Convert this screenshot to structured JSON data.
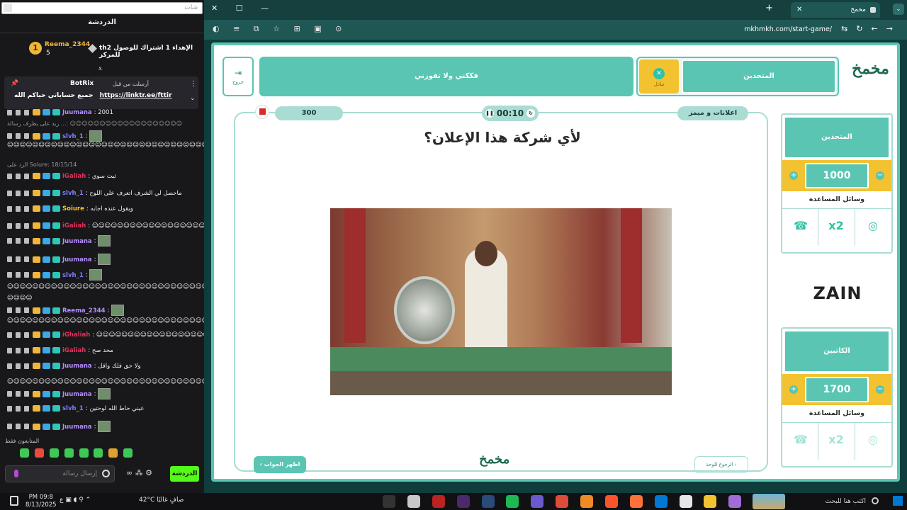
{
  "chat": {
    "search_placeholder": "شات",
    "title": "الدردشة",
    "hype": {
      "level": "1",
      "user": "Reema_2344",
      "count": "5",
      "text": "th2 الإهداء 1 اشتراك للوصول للمركز"
    },
    "pinned": {
      "by_label": "أرسلت من قبل",
      "bot_name": "BotRix",
      "message": "جميع حساباتي حياكم الله",
      "link": "https://linktr.ee/fttir"
    },
    "messages": [
      {
        "user": "Juumana",
        "text": "2001",
        "color": "#b58cff"
      },
      {
        "reply": "ريد على يطرف رسالة ...: ☺☺☺☺☺☺☺☺☺☺☺☺☺☺☺☺☺☺☺"
      },
      {
        "user": "slvh_1",
        "text": "",
        "color": "#7d7dff"
      },
      {
        "text_only": "☺☺☺☺☺☺☺☺☺☺☺☺☺☺☺☺☺☺☺☺☺☺☺☺☺☺☺☺☺☺☺☺☺☺☺☺☺☺☺☺☺☺☺☺☺☺☺☺☺☺☺☺☺"
      },
      {
        "reply": "الرد على Soiure: 18/15/14"
      },
      {
        "user": "iGaliah",
        "text": "ثبت سوي",
        "color": "#e0315b"
      },
      {
        "user": "slvh_1",
        "text": "ماحصل لي الشرف اتعرف على اللوح",
        "color": "#7d7dff"
      },
      {
        "user": "Soiure",
        "text": "ويقول عنده اجابه",
        "color": "#f2c230"
      },
      {
        "user": "iGaliah",
        "text": "☺☺☺☺☺☺☺☺☺☺☺☺☺☺☺☺☺☺☺☺☺☺☺☺☺☺",
        "color": "#e0315b"
      },
      {
        "user": "Juumana",
        "text": "",
        "color": "#b58cff"
      },
      {
        "user": "Juumana",
        "text": "",
        "color": "#b58cff"
      },
      {
        "user": "slvh_1",
        "text": "",
        "color": "#7d7dff"
      },
      {
        "text_only": "☺☺☺☺☺☺☺☺☺☺☺☺☺☺☺☺☺☺☺☺☺☺☺☺☺☺☺☺☺☺☺☺☺☺☺☺☺☺☺☺☺☺☺☺☺☺☺☺☺☺☺☺☺"
      },
      {
        "text_only": "☺☺☺☺"
      },
      {
        "user": "Reema_2344",
        "text": "",
        "color": "#b58cff"
      },
      {
        "text_only": "☺☺☺☺☺☺☺☺☺☺☺☺☺☺☺☺☺☺☺☺☺☺☺☺☺☺☺☺☺☺☺☺☺☺☺☺☺☺☺☺☺☺☺☺☺☺☺☺☺☺"
      },
      {
        "user": "iGhaliah",
        "text": "☺☺☺☺☺☺☺☺☺☺☺☺☺☺☺☺☺☺☺☺☺☺☺☺☺☺☺☺☺☺☺☺☺☺☺",
        "color": "#e0315b"
      },
      {
        "user": "iGaliah",
        "text": "محد صح",
        "color": "#e0315b"
      },
      {
        "user": "Juumana",
        "text": "ولا حق فلك واقل",
        "color": "#b58cff"
      },
      {
        "text_only": "☺☺☺☺☺☺☺☺☺☺☺☺☺☺☺☺☺☺☺☺☺☺☺☺☺☺☺☺☺☺☺☺☺☺☺☺☺☺☺☺☺☺☺☺☺☺☺☺"
      },
      {
        "user": "Juumana",
        "text": "",
        "color": "#b58cff"
      },
      {
        "user": "slvh_1",
        "text": "عيني حاط الله لوحتين",
        "color": "#7d7dff"
      },
      {
        "user": "Juumana",
        "text": "",
        "color": "#b58cff"
      }
    ],
    "followers_only": "المتابعون فقط",
    "input_placeholder": "إرسال رسالة",
    "send_label": "الدردشة",
    "accent": "#53fc18"
  },
  "browser": {
    "tab_title": "مخمخ",
    "url": "mkhmkh.com/start-game/"
  },
  "game": {
    "team1_name": "المتحدين",
    "team1_swap_label": "تبادل",
    "team2_name": "فككني ولا تفوزني",
    "exit_label": "خروج",
    "points": "300",
    "timer": "00:10",
    "category": "اعلانات و ميمز",
    "question": "لأي شركة هذا الإعلان؟",
    "show_answer": "اظهر الجواب",
    "back_to_board": "الرجوع للوحة",
    "logo": "مخمخ",
    "teams": [
      {
        "name": "المتحدين",
        "score": "1000",
        "aids_title": "وسائل المساعدة",
        "aids": [
          "phone-call-icon",
          "double-points-icon",
          "hole-icon"
        ]
      },
      {
        "name": "الكاتبين",
        "score": "1700",
        "aids_title": "وسائل المساعدة",
        "aids": [
          "phone-call-icon",
          "double-points-icon",
          "hole-icon"
        ]
      }
    ],
    "sponsor": "ZAIN",
    "accent": "#5ac5b3",
    "yellow": "#f2c230"
  },
  "taskbar": {
    "search_placeholder": "اكتب هنا للبحث",
    "time": "PM 09:8",
    "date": "8/13/2025",
    "weather": "42°C صافٍ غالبًا",
    "lang": "ع"
  }
}
